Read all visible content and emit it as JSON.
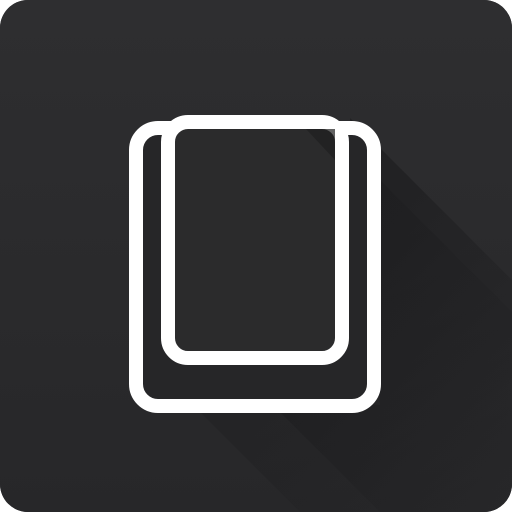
{
  "app_icon": {
    "icon": "copy-pages-icon",
    "colors": {
      "background": "#2c2c2e",
      "long_shadow": "#1c1c1e",
      "outline": "#ffffff",
      "page_fill": "#2a2a2b"
    }
  }
}
